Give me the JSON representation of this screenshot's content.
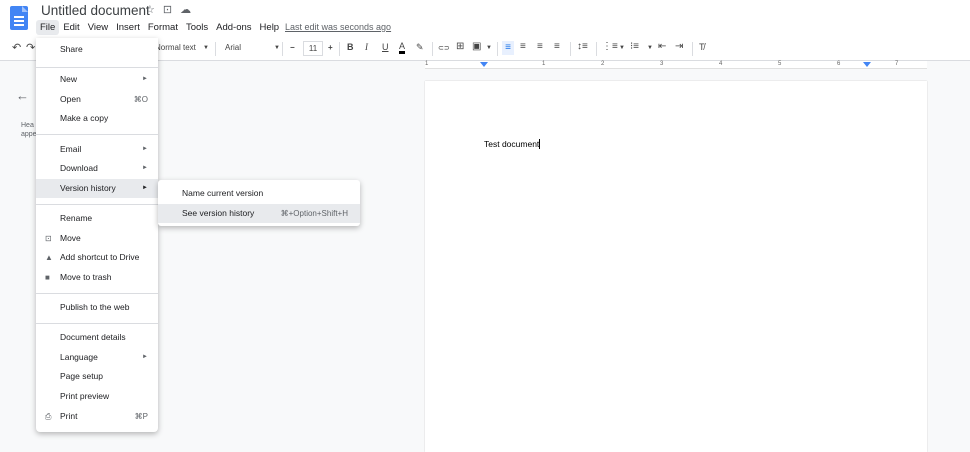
{
  "header": {
    "title": "Untitled document",
    "star_icon": "☆",
    "folder_icon": "⊡",
    "cloud_icon": "☁",
    "menu": [
      "File",
      "Edit",
      "View",
      "Insert",
      "Format",
      "Tools",
      "Add-ons",
      "Help"
    ],
    "last_edit": "Last edit was seconds ago"
  },
  "toolbar": {
    "undo": "↶",
    "redo": "↷",
    "style": "Normal text",
    "font": "Arial",
    "font_size": "11",
    "minus": "−",
    "plus": "+",
    "bold": "B",
    "italic": "I",
    "underline": "U",
    "text_color": "A",
    "highlight": "✎",
    "link": "⊂⊃",
    "comment": "⊞",
    "image": "▣",
    "clear_format": "T̸"
  },
  "ruler": {
    "numbers": [
      "1",
      "1",
      "2",
      "3",
      "4",
      "5",
      "6",
      "7"
    ]
  },
  "outline": {
    "back": "←",
    "text_line1": "Hea",
    "text_line2": "appe"
  },
  "document": {
    "body_text": "Test document"
  },
  "file_menu": {
    "share": "Share",
    "new": "New",
    "open": "Open",
    "open_shortcut": "⌘O",
    "make_copy": "Make a copy",
    "email": "Email",
    "download": "Download",
    "version_history": "Version history",
    "rename": "Rename",
    "move": "Move",
    "add_shortcut": "Add shortcut to Drive",
    "move_trash": "Move to trash",
    "publish": "Publish to the web",
    "doc_details": "Document details",
    "language": "Language",
    "page_setup": "Page setup",
    "print_preview": "Print preview",
    "print": "Print",
    "print_shortcut": "⌘P",
    "submenu_arrow": "►"
  },
  "submenu": {
    "name_version": "Name current version",
    "see_history": "See version history",
    "see_history_shortcut": "⌘+Option+Shift+H"
  },
  "colors": {
    "accent": "#4285f4",
    "highlight": "#e8eaed"
  }
}
